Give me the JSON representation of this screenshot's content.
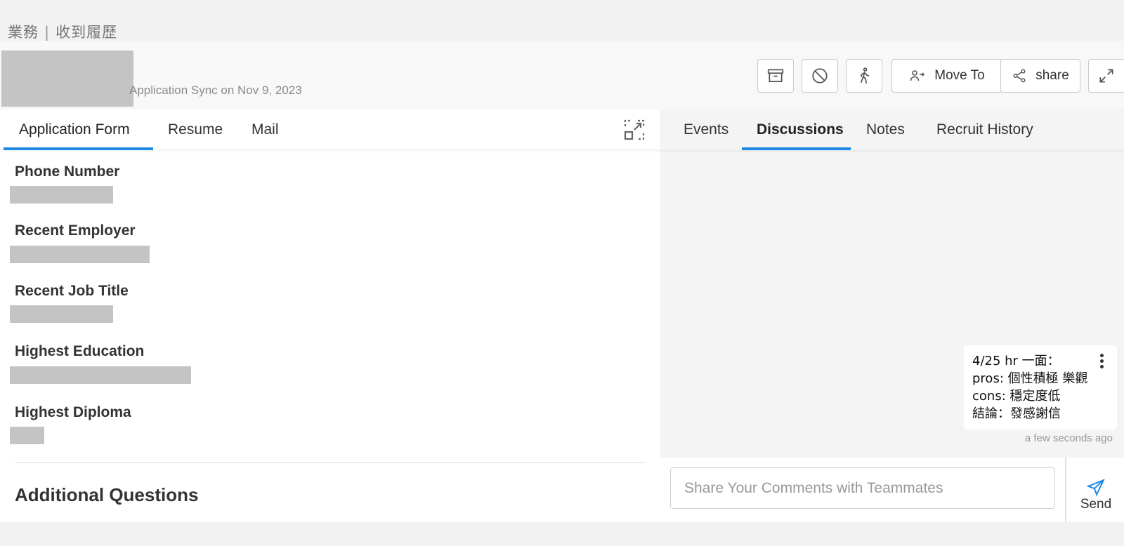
{
  "breadcrumb": {
    "part1": "業務",
    "separator": "|",
    "part2": "收到履歷"
  },
  "header": {
    "sync_text": "Application Sync on Nov 9, 2023",
    "actions": {
      "archive_icon": "archive-box-icon",
      "block_icon": "block-circle-icon",
      "walk_icon": "walking-person-icon",
      "move_to_label": "Move To",
      "share_label": "share",
      "expand_icon": "expand-arrows-icon"
    }
  },
  "left_tabs": [
    {
      "label": "Application Form",
      "active": true
    },
    {
      "label": "Resume",
      "active": false
    },
    {
      "label": "Mail",
      "active": false
    }
  ],
  "form": {
    "fields": [
      {
        "label": "Phone Number"
      },
      {
        "label": "Recent Employer"
      },
      {
        "label": "Recent Job Title"
      },
      {
        "label": "Highest Education"
      },
      {
        "label": "Highest Diploma"
      }
    ],
    "section_title": "Additional Questions"
  },
  "right_tabs": [
    {
      "label": "Events",
      "active": false
    },
    {
      "label": "Discussions",
      "active": true
    },
    {
      "label": "Notes",
      "active": false
    },
    {
      "label": "Recruit History",
      "active": false
    }
  ],
  "discussion": {
    "comment_lines": [
      "4/25 hr 一面：",
      "pros: 個性積極 樂觀",
      "cons: 穩定度低",
      "結論：發感謝信"
    ],
    "time": "a few seconds ago"
  },
  "compose": {
    "placeholder": "Share Your Comments with Teammates",
    "value": "",
    "send_label": "Send"
  },
  "colors": {
    "accent": "#1e88e5",
    "redacted": "#c4c4c4"
  }
}
